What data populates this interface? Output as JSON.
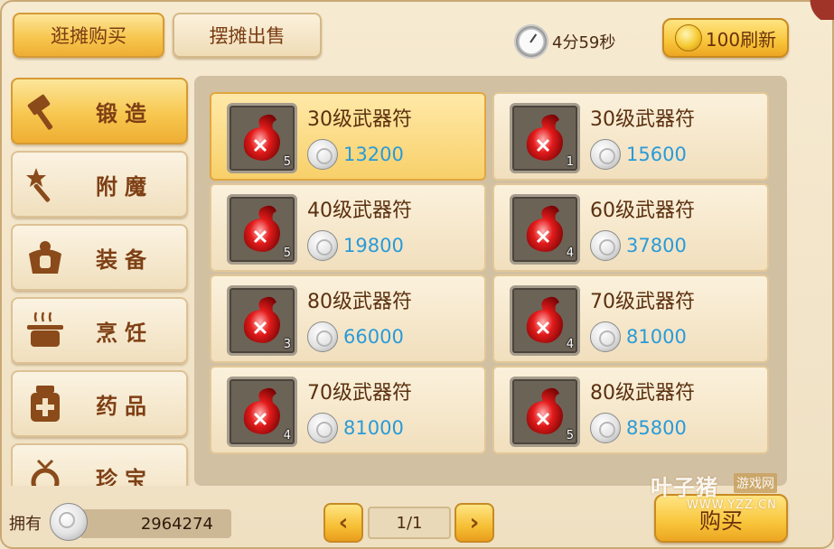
{
  "header": {
    "tabs": [
      {
        "label": "逛摊购买",
        "active": true
      },
      {
        "label": "摆摊出售",
        "active": false
      }
    ],
    "timer": "4分59秒",
    "refresh_label": "100刷新"
  },
  "categories": [
    {
      "label": "锻造",
      "icon": "hammer-icon",
      "active": true
    },
    {
      "label": "附魔",
      "icon": "magic-wand-icon",
      "active": false
    },
    {
      "label": "装备",
      "icon": "armor-icon",
      "active": false
    },
    {
      "label": "烹饪",
      "icon": "cooking-pot-icon",
      "active": false
    },
    {
      "label": "药品",
      "icon": "medicine-bottle-icon",
      "active": false
    },
    {
      "label": "珍宝",
      "icon": "treasure-ring-icon",
      "active": false
    }
  ],
  "items": [
    {
      "name": "30级武器符",
      "price": "13200",
      "count": "5",
      "selected": true
    },
    {
      "name": "30级武器符",
      "price": "15600",
      "count": "1",
      "selected": false
    },
    {
      "name": "40级武器符",
      "price": "19800",
      "count": "5",
      "selected": false
    },
    {
      "name": "60级武器符",
      "price": "37800",
      "count": "4",
      "selected": false
    },
    {
      "name": "80级武器符",
      "price": "66000",
      "count": "3",
      "selected": false
    },
    {
      "name": "70级武器符",
      "price": "81000",
      "count": "4",
      "selected": false
    },
    {
      "name": "70级武器符",
      "price": "81000",
      "count": "4",
      "selected": false
    },
    {
      "name": "80级武器符",
      "price": "85800",
      "count": "5",
      "selected": false
    }
  ],
  "footer": {
    "own_label": "拥有",
    "own_amount": "2964274",
    "prev_symbol": "‹",
    "page": "1/1",
    "next_symbol": "›",
    "buy_label": "购买"
  },
  "watermark": {
    "main": "叶子猪",
    "tag": "游戏网",
    "url": "WWW.YZZ.CN"
  },
  "colors": {
    "price": "#2a9bd8",
    "tab_active": "#f7c74f",
    "label_brown": "#7e3f14"
  }
}
